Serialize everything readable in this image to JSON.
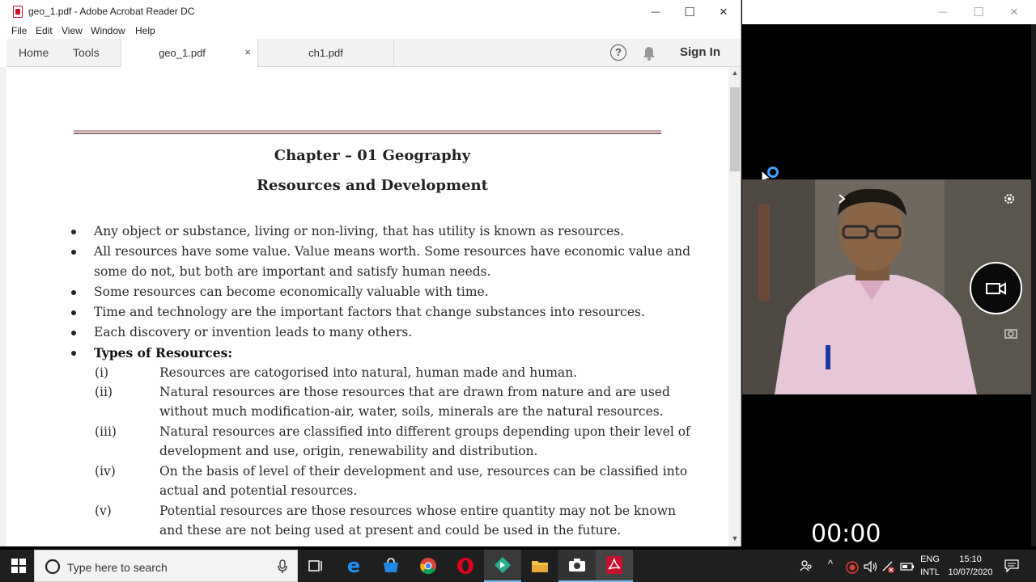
{
  "window": {
    "title": "geo_1.pdf - Adobe Acrobat Reader DC",
    "controls": {
      "minimize": "—",
      "maximize": "☐",
      "close": "✕"
    }
  },
  "menu": [
    "File",
    "Edit",
    "View",
    "Window",
    "Help"
  ],
  "toolbar": {
    "home": "Home",
    "tools": "Tools",
    "tabs": [
      {
        "label": "geo_1.pdf",
        "close": "×"
      },
      {
        "label": "ch1.pdf"
      }
    ],
    "help": "?",
    "sign_in": "Sign In"
  },
  "document": {
    "chapter_title": "Chapter – 01 Geography",
    "subtitle": "Resources and Development",
    "bullets": [
      [
        "Any object or substance, living or non-living, that has utility is known as resources."
      ],
      [
        "All resources have some value. Value means worth. Some resources have economic value and",
        "some do not, but both are important and satisfy human needs."
      ],
      [
        "Some resources can become economically valuable with time."
      ],
      [
        "Time and technology are the important factors that change substances into resources."
      ],
      [
        "Each discovery or invention leads to many others."
      ]
    ],
    "types_heading": "Types of Resources:",
    "types": [
      {
        "num": "(i)",
        "lines": [
          "Resources are catogorised into natural, human made and human."
        ]
      },
      {
        "num": "(ii)",
        "lines": [
          "Natural resources are those resources that are drawn from nature and are used",
          "without much modification-air, water, soils, minerals are the natural resources."
        ]
      },
      {
        "num": "(iii)",
        "lines": [
          "Natural resources are classified into different groups depending upon their level of",
          "development and use, origin, renewability and distribution."
        ]
      },
      {
        "num": "(iv)",
        "lines": [
          "On the basis of level of their development and use, resources can be classified into",
          "actual and potential resources."
        ]
      },
      {
        "num": "(v)",
        "lines": [
          "Potential resources are those resources whose entire quantity may not be known",
          "and these are not being used at present and could be used in the future."
        ]
      }
    ]
  },
  "recorder": {
    "timer": "00:00"
  },
  "taskbar": {
    "search_placeholder": "Type here to search",
    "lang_top": "ENG",
    "lang_bottom": "INTL",
    "time": "15:10",
    "date": "10/07/2020"
  }
}
